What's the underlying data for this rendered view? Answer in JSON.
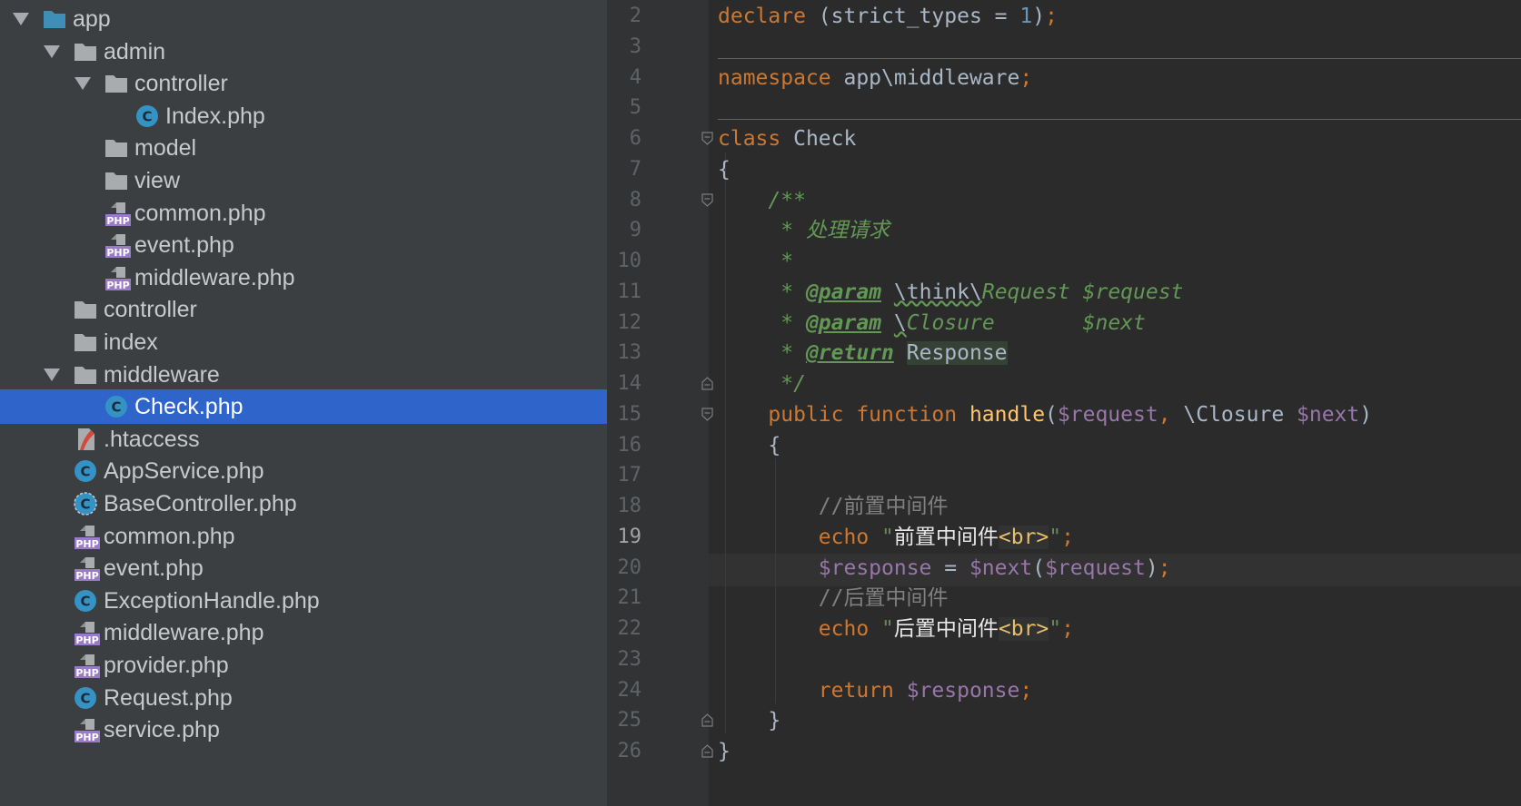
{
  "tree": {
    "items": [
      {
        "label": "app",
        "type": "folder-blue",
        "depth": 0,
        "arrow": "down"
      },
      {
        "label": "admin",
        "type": "folder",
        "depth": 1,
        "arrow": "down"
      },
      {
        "label": "controller",
        "type": "folder",
        "depth": 2,
        "arrow": "down"
      },
      {
        "label": "Index.php",
        "type": "class",
        "depth": 3,
        "arrow": "none"
      },
      {
        "label": "model",
        "type": "folder",
        "depth": 2,
        "arrow": "none"
      },
      {
        "label": "view",
        "type": "folder",
        "depth": 2,
        "arrow": "none"
      },
      {
        "label": "common.php",
        "type": "php",
        "depth": 2,
        "arrow": "none"
      },
      {
        "label": "event.php",
        "type": "php",
        "depth": 2,
        "arrow": "none"
      },
      {
        "label": "middleware.php",
        "type": "php",
        "depth": 2,
        "arrow": "none"
      },
      {
        "label": "controller",
        "type": "folder",
        "depth": 1,
        "arrow": "right"
      },
      {
        "label": "index",
        "type": "folder",
        "depth": 1,
        "arrow": "right"
      },
      {
        "label": "middleware",
        "type": "folder",
        "depth": 1,
        "arrow": "down"
      },
      {
        "label": "Check.php",
        "type": "class",
        "depth": 2,
        "arrow": "none",
        "selected": true
      },
      {
        "label": ".htaccess",
        "type": "htaccess",
        "depth": 1,
        "arrow": "none"
      },
      {
        "label": "AppService.php",
        "type": "class",
        "depth": 1,
        "arrow": "none"
      },
      {
        "label": "BaseController.php",
        "type": "class-abstract",
        "depth": 1,
        "arrow": "none"
      },
      {
        "label": "common.php",
        "type": "php",
        "depth": 1,
        "arrow": "none"
      },
      {
        "label": "event.php",
        "type": "php",
        "depth": 1,
        "arrow": "none"
      },
      {
        "label": "ExceptionHandle.php",
        "type": "class",
        "depth": 1,
        "arrow": "none"
      },
      {
        "label": "middleware.php",
        "type": "php",
        "depth": 1,
        "arrow": "none"
      },
      {
        "label": "provider.php",
        "type": "php",
        "depth": 1,
        "arrow": "none"
      },
      {
        "label": "Request.php",
        "type": "class",
        "depth": 1,
        "arrow": "none"
      },
      {
        "label": "service.php",
        "type": "php",
        "depth": 1,
        "arrow": "none"
      }
    ],
    "icon_letters": {
      "class": "C",
      "php": "PHP"
    }
  },
  "editor": {
    "current_line": 19,
    "lines": [
      {
        "n": 2,
        "tokens": [
          [
            "kw",
            "declare"
          ],
          [
            "plain",
            " (strict_types = "
          ],
          [
            "num",
            "1"
          ],
          [
            "plain",
            ")"
          ],
          [
            "kw",
            ";"
          ]
        ]
      },
      {
        "n": 3,
        "tokens": []
      },
      {
        "n": 4,
        "tokens": [
          [
            "kw",
            "namespace"
          ],
          [
            "plain",
            " app\\middleware"
          ],
          [
            "kw",
            ";"
          ]
        ]
      },
      {
        "n": 5,
        "tokens": []
      },
      {
        "n": 6,
        "fold": "open",
        "tokens": [
          [
            "kw",
            "class"
          ],
          [
            "plain",
            " Check"
          ]
        ]
      },
      {
        "n": 7,
        "tokens": [
          [
            "plain",
            "{"
          ]
        ]
      },
      {
        "n": 8,
        "fold": "open",
        "tokens": [
          [
            "plain",
            "    "
          ],
          [
            "doc",
            "/**"
          ]
        ]
      },
      {
        "n": 9,
        "tokens": [
          [
            "plain",
            "     "
          ],
          [
            "doc",
            "* 处理请求"
          ]
        ]
      },
      {
        "n": 10,
        "tokens": [
          [
            "plain",
            "     "
          ],
          [
            "doc",
            "*"
          ]
        ]
      },
      {
        "n": 11,
        "tokens": [
          [
            "plain",
            "     "
          ],
          [
            "doc",
            "* "
          ],
          [
            "doctag",
            "@param"
          ],
          [
            "doc",
            " "
          ],
          [
            "wavy",
            "\\think\\"
          ],
          [
            "docref",
            "Request"
          ],
          [
            "doc",
            " $request"
          ]
        ]
      },
      {
        "n": 12,
        "tokens": [
          [
            "plain",
            "     "
          ],
          [
            "doc",
            "* "
          ],
          [
            "doctag",
            "@param"
          ],
          [
            "doc",
            " "
          ],
          [
            "wavy",
            "\\"
          ],
          [
            "docref",
            "Closure"
          ],
          [
            "doc",
            "       $next"
          ]
        ]
      },
      {
        "n": 13,
        "tokens": [
          [
            "plain",
            "     "
          ],
          [
            "doc",
            "* "
          ],
          [
            "doctag",
            "@return"
          ],
          [
            "doc",
            " "
          ],
          [
            "hl",
            "Response"
          ]
        ]
      },
      {
        "n": 14,
        "fold": "close",
        "tokens": [
          [
            "plain",
            "     "
          ],
          [
            "doc",
            "*/"
          ]
        ]
      },
      {
        "n": 15,
        "fold": "open",
        "tokens": [
          [
            "plain",
            "    "
          ],
          [
            "kw",
            "public function "
          ],
          [
            "fn",
            "handle"
          ],
          [
            "plain",
            "("
          ],
          [
            "var",
            "$request"
          ],
          [
            "kw",
            ", "
          ],
          [
            "plain",
            "\\Closure "
          ],
          [
            "var",
            "$next"
          ],
          [
            "plain",
            ")"
          ]
        ]
      },
      {
        "n": 16,
        "tokens": [
          [
            "plain",
            "    {"
          ]
        ]
      },
      {
        "n": 17,
        "tokens": []
      },
      {
        "n": 18,
        "tokens": [
          [
            "plain",
            "        "
          ],
          [
            "cmt",
            "//前置中间件"
          ]
        ]
      },
      {
        "n": 19,
        "tokens": [
          [
            "plain",
            "        "
          ],
          [
            "kw",
            "echo "
          ],
          [
            "str",
            "\""
          ],
          [
            "strtxt",
            "前置中间件"
          ],
          [
            "strtag",
            "<br>"
          ],
          [
            "str",
            "\""
          ],
          [
            "kw",
            ";"
          ]
        ]
      },
      {
        "n": 20,
        "tokens": [
          [
            "plain",
            "        "
          ],
          [
            "var",
            "$response"
          ],
          [
            "plain",
            " = "
          ],
          [
            "var",
            "$next"
          ],
          [
            "plain",
            "("
          ],
          [
            "var",
            "$request"
          ],
          [
            "plain",
            ")"
          ],
          [
            "kw",
            ";"
          ]
        ]
      },
      {
        "n": 21,
        "tokens": [
          [
            "plain",
            "        "
          ],
          [
            "cmt",
            "//后置中间件"
          ]
        ]
      },
      {
        "n": 22,
        "tokens": [
          [
            "plain",
            "        "
          ],
          [
            "kw",
            "echo "
          ],
          [
            "str",
            "\""
          ],
          [
            "strtxt",
            "后置中间件"
          ],
          [
            "strtag",
            "<br>"
          ],
          [
            "str",
            "\""
          ],
          [
            "kw",
            ";"
          ]
        ]
      },
      {
        "n": 23,
        "tokens": []
      },
      {
        "n": 24,
        "tokens": [
          [
            "plain",
            "        "
          ],
          [
            "kw",
            "return "
          ],
          [
            "var",
            "$response"
          ],
          [
            "kw",
            ";"
          ]
        ]
      },
      {
        "n": 25,
        "fold": "close",
        "tokens": [
          [
            "plain",
            "    }"
          ]
        ]
      },
      {
        "n": 26,
        "fold": "close",
        "tokens": [
          [
            "plain",
            "}"
          ]
        ]
      }
    ]
  },
  "colors": {
    "tree_bg": "#3c3f41",
    "selection": "#2f65ca",
    "editor_bg": "#2b2b2b",
    "keyword": "#cc7832",
    "string": "#6a8759",
    "variable": "#9876aa",
    "function": "#ffc66d",
    "doc_comment": "#629755"
  }
}
